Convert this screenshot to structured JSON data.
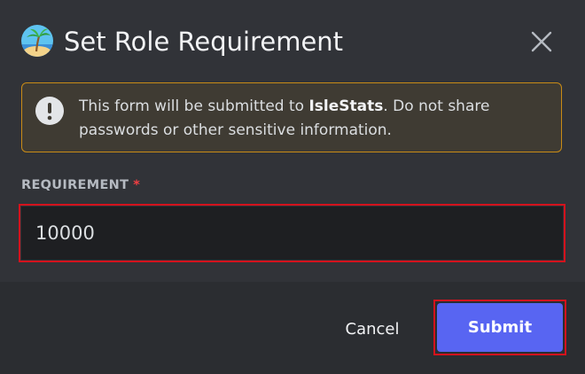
{
  "modal": {
    "title": "Set Role Requirement",
    "icon": "island-avatar-icon",
    "close_icon": "close-icon"
  },
  "notice": {
    "icon": "exclamation-circle-icon",
    "text_before": "This form will be submitted to ",
    "app_name": "IsleStats",
    "text_after": ". Do not share passwords or other sensitive information.",
    "border_color": "#c98b16"
  },
  "form": {
    "field_label": "REQUIREMENT",
    "required_marker": "*",
    "value": "10000"
  },
  "footer": {
    "cancel_label": "Cancel",
    "submit_label": "Submit",
    "submit_color": "#5865f2"
  }
}
